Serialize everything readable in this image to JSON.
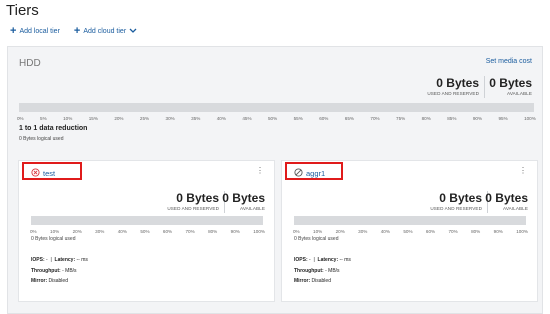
{
  "page": {
    "title": "Tiers"
  },
  "toolbar": {
    "add_local": "Add local tier",
    "add_cloud": "Add cloud tier"
  },
  "hdd": {
    "title": "HDD",
    "media_cost_link": "Set media cost",
    "used": {
      "value": "0 Bytes",
      "label": "USED AND RESERVED"
    },
    "available": {
      "value": "0 Bytes",
      "label": "AVAILABLE"
    },
    "used_fraction": 0,
    "ticks": [
      "0%",
      "5%",
      "10%",
      "15%",
      "20%",
      "25%",
      "30%",
      "35%",
      "40%",
      "45%",
      "50%",
      "55%",
      "60%",
      "65%",
      "70%",
      "75%",
      "80%",
      "85%",
      "90%",
      "95%",
      "100%"
    ],
    "data_reduction": "1 to 1 data reduction",
    "logical_used": "0 Bytes logical used"
  },
  "cards": [
    {
      "name": "test",
      "status_icon": "error-circle-icon",
      "status_color": "#d9363e",
      "used": {
        "value": "0 Bytes",
        "label": "USED AND RESERVED"
      },
      "available": {
        "value": "0 Bytes",
        "label": "AVAILABLE"
      },
      "used_fraction": 0,
      "ticks": [
        "0%",
        "10%",
        "20%",
        "30%",
        "40%",
        "50%",
        "60%",
        "70%",
        "80%",
        "90%",
        "100%"
      ],
      "logical_used": "0 Bytes logical used",
      "iops_label": "IOPS:",
      "iops_value": "-",
      "latency_label": "Latency:",
      "latency_value": "-- ms",
      "throughput_label": "Throughput:",
      "throughput_value": "- MB/s",
      "mirror_label": "Mirror:",
      "mirror_value": "Disabled"
    },
    {
      "name": "aggr1",
      "status_icon": "offline-circle-icon",
      "status_color": "#555555",
      "used": {
        "value": "0 Bytes",
        "label": "USED AND RESERVED"
      },
      "available": {
        "value": "0 Bytes",
        "label": "AVAILABLE"
      },
      "used_fraction": 0,
      "ticks": [
        "0%",
        "10%",
        "20%",
        "30%",
        "40%",
        "50%",
        "60%",
        "70%",
        "80%",
        "90%",
        "100%"
      ],
      "logical_used": "0 Bytes logical used",
      "iops_label": "IOPS:",
      "iops_value": "-",
      "latency_label": "Latency:",
      "latency_value": "-- ms",
      "throughput_label": "Throughput:",
      "throughput_value": "- MB/s",
      "mirror_label": "Mirror:",
      "mirror_value": "Disabled"
    }
  ],
  "colors": {
    "link": "#1a5c9e",
    "highlight": "#e01b1b"
  }
}
